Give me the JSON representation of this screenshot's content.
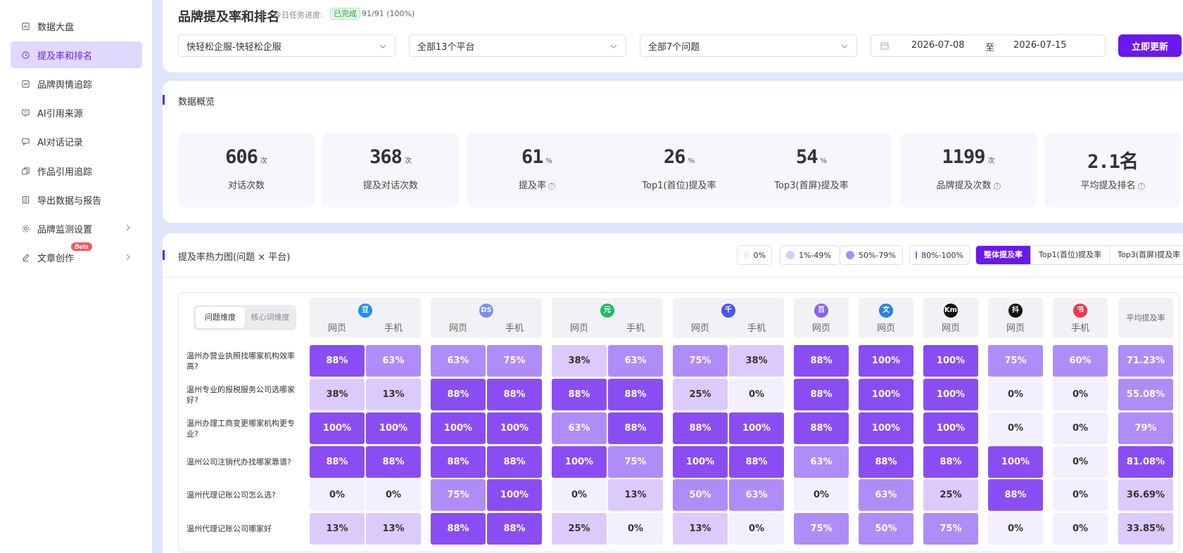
{
  "sidebar": {
    "items": [
      {
        "label": "数据大盘",
        "icon": "dashboard-icon",
        "active": false,
        "chevron": false
      },
      {
        "label": "提及率和排名",
        "icon": "clock-icon",
        "active": true,
        "chevron": false
      },
      {
        "label": "品牌舆情追踪",
        "icon": "trend-icon",
        "active": false,
        "chevron": false
      },
      {
        "label": "AI引用来源",
        "icon": "monitor-icon",
        "active": false,
        "chevron": false
      },
      {
        "label": "AI对话记录",
        "icon": "chat-icon",
        "active": false,
        "chevron": false
      },
      {
        "label": "作品引用追踪",
        "icon": "copy-icon",
        "active": false,
        "chevron": false
      },
      {
        "label": "导出数据与报告",
        "icon": "export-icon",
        "active": false,
        "chevron": false
      },
      {
        "label": "品牌监测设置",
        "icon": "gear-icon",
        "active": false,
        "chevron": true
      },
      {
        "label": "文章创作",
        "icon": "edit-icon",
        "active": false,
        "chevron": true,
        "badge": "Beta"
      }
    ]
  },
  "header": {
    "title": "品牌提及率和排名",
    "progress_label": "今日任务进度:",
    "progress_status": "已完成",
    "progress_count": "91/91 (100%)"
  },
  "filters": {
    "brand": "快轻松企服-快轻松企服",
    "platform": "全部13个平台",
    "question": "全部7个问题",
    "date_start": "2026-07-08",
    "date_sep": "至",
    "date_end": "2026-07-15",
    "update_button": "立即更新"
  },
  "overview": {
    "title": "数据概览",
    "stats": [
      {
        "value": "606",
        "unit": "次",
        "label": "对话次数",
        "help": false
      },
      {
        "value": "368",
        "unit": "次",
        "label": "提及对话次数",
        "help": false
      },
      {
        "value": "61",
        "unit": "%",
        "label": "提及率",
        "help": true
      },
      {
        "value": "26",
        "unit": "%",
        "label": "Top1(首位)提及率",
        "help": false
      },
      {
        "value": "54",
        "unit": "%",
        "label": "Top3(首屏)提及率",
        "help": false
      },
      {
        "value": "1199",
        "unit": "次",
        "label": "品牌提及次数",
        "help": true
      },
      {
        "value": "2.1名",
        "unit": "",
        "label": "平均提及排名",
        "help": true
      }
    ]
  },
  "heatmap": {
    "title": "提及率热力图(问题 × 平台)",
    "legend": [
      {
        "label": "0%",
        "color": "#f4effe"
      },
      {
        "label": "1%-49%",
        "color": "#dccafc"
      },
      {
        "label": "50%-79%",
        "color": "#b08cf8"
      },
      {
        "label": "80%-100%",
        "color": "#8a4df4"
      }
    ],
    "modes": [
      "整体提及率",
      "Top1(首位)提及率",
      "Top3(首屏)提及率"
    ],
    "active_mode": 0,
    "dimensions": [
      "问题维度",
      "核心词维度"
    ],
    "active_dimension": 0,
    "platforms": [
      {
        "logo": "豆",
        "color": "#1e8ff5",
        "subs": [
          "网页",
          "手机"
        ]
      },
      {
        "logo": "DS",
        "color": "#7c8ff2",
        "subs": [
          "网页",
          "手机"
        ]
      },
      {
        "logo": "元",
        "color": "#1ebd65",
        "subs": [
          "网页",
          "手机"
        ]
      },
      {
        "logo": "千",
        "color": "#4b55f0",
        "subs": [
          "网页",
          "手机"
        ]
      },
      {
        "logo": "百",
        "color": "#8a60f2",
        "subs": [
          "网页"
        ]
      },
      {
        "logo": "文",
        "color": "#2a7fe6",
        "subs": [
          "网页"
        ]
      },
      {
        "logo": "Km",
        "color": "#111111",
        "subs": [
          "网页"
        ]
      },
      {
        "logo": "抖",
        "color": "#111111",
        "subs": [
          "网页"
        ]
      },
      {
        "logo": "书",
        "color": "#f0384a",
        "subs": [
          "手机"
        ]
      }
    ],
    "avg_header": "平均提及率",
    "rows": [
      {
        "question": "温州办营业执照找哪家机构效率高?",
        "values": [
          "88%",
          "63%",
          "63%",
          "75%",
          "38%",
          "63%",
          "75%",
          "38%",
          "88%",
          "100%",
          "100%",
          "75%",
          "60%"
        ],
        "avg": "71.23%"
      },
      {
        "question": "温州专业的报税服务公司选哪家好?",
        "values": [
          "38%",
          "13%",
          "88%",
          "88%",
          "88%",
          "88%",
          "25%",
          "0%",
          "88%",
          "100%",
          "100%",
          "0%",
          "0%"
        ],
        "avg": "55.08%"
      },
      {
        "question": "温州办理工商变更哪家机构更专业?",
        "values": [
          "100%",
          "100%",
          "100%",
          "100%",
          "63%",
          "88%",
          "88%",
          "100%",
          "88%",
          "100%",
          "100%",
          "0%",
          "0%"
        ],
        "avg": "79%"
      },
      {
        "question": "温州公司注销代办找哪家靠谱?",
        "values": [
          "88%",
          "88%",
          "88%",
          "88%",
          "100%",
          "75%",
          "100%",
          "88%",
          "63%",
          "88%",
          "88%",
          "100%",
          "0%"
        ],
        "avg": "81.08%"
      },
      {
        "question": "温州代理记账公司怎么选?",
        "values": [
          "0%",
          "0%",
          "75%",
          "100%",
          "0%",
          "13%",
          "50%",
          "63%",
          "0%",
          "63%",
          "25%",
          "88%",
          "0%"
        ],
        "avg": "36.69%"
      },
      {
        "question": "温州代理记账公司哪家好",
        "values": [
          "13%",
          "13%",
          "88%",
          "88%",
          "25%",
          "0%",
          "13%",
          "0%",
          "75%",
          "50%",
          "75%",
          "0%",
          "0%"
        ],
        "avg": "33.85%"
      }
    ]
  }
}
